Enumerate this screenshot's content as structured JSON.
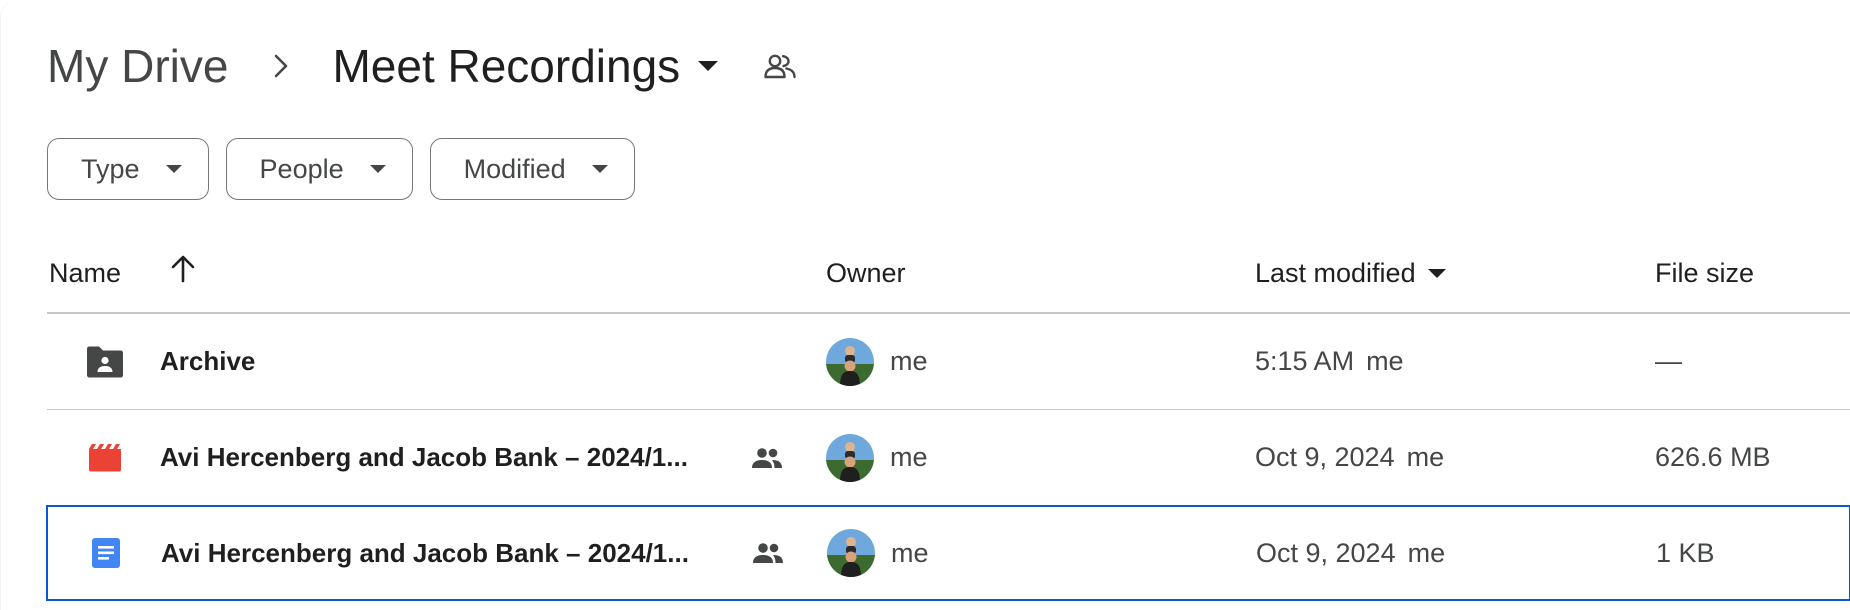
{
  "breadcrumb": {
    "root": "My Drive",
    "separator": "›",
    "current": "Meet Recordings",
    "shared_icon": "people-outline-icon"
  },
  "filters": [
    {
      "label": "Type"
    },
    {
      "label": "People"
    },
    {
      "label": "Modified"
    }
  ],
  "table": {
    "columns": {
      "name": "Name",
      "owner": "Owner",
      "last_modified": "Last modified",
      "file_size": "File size"
    },
    "sort_icon": "arrow-up-icon",
    "rows": [
      {
        "icon": "shared-folder-icon",
        "name": "Archive",
        "shared": false,
        "owner": "me",
        "modified_date": "5:15 AM",
        "modified_by": "me",
        "size": "—"
      },
      {
        "icon": "video-file-icon",
        "name": "Avi Hercenberg and Jacob Bank – 2024/1...",
        "shared": true,
        "owner": "me",
        "modified_date": "Oct 9, 2024",
        "modified_by": "me",
        "size": "626.6 MB"
      },
      {
        "icon": "google-doc-icon",
        "name": "Avi Hercenberg and Jacob Bank – 2024/1...",
        "shared": true,
        "owner": "me",
        "modified_date": "Oct 9, 2024",
        "modified_by": "me",
        "size": "1 KB",
        "selected": true
      }
    ]
  },
  "colors": {
    "selection_border": "#0b57d0",
    "video_icon": "#ea4335",
    "doc_icon": "#4285f4",
    "folder_icon": "#444746"
  }
}
